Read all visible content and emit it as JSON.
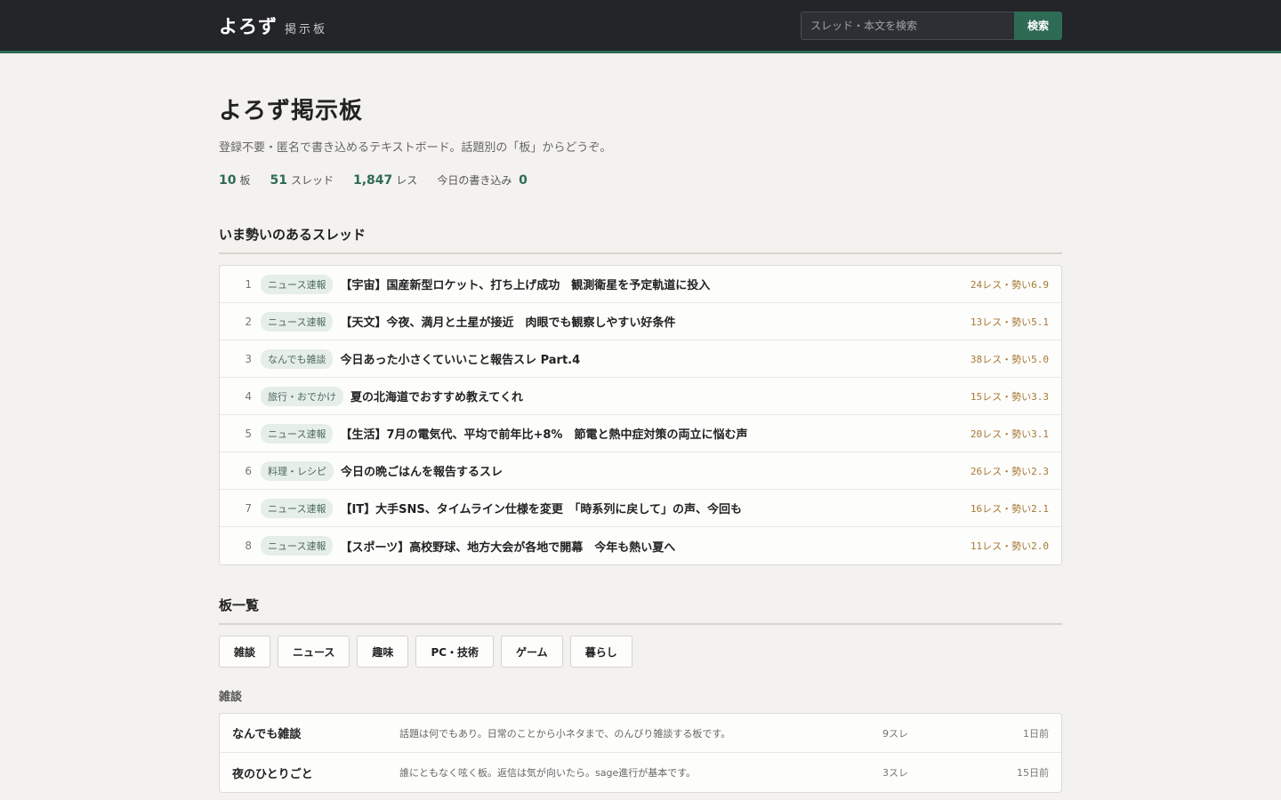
{
  "header": {
    "brand": "よろず",
    "brand_sub": "掲示板",
    "search_placeholder": "スレッド・本文を検索",
    "search_button": "検索"
  },
  "hero": {
    "title": "よろず掲示板",
    "description": "登録不要・匿名で書き込めるテキストボード。話題別の「板」からどうぞ。",
    "stats": [
      {
        "num": "10",
        "label": "板"
      },
      {
        "num": "51",
        "label": "スレッド"
      },
      {
        "num": "1,847",
        "label": "レス"
      },
      {
        "num": "0",
        "label": "今日の書き込み",
        "label_first": true
      }
    ]
  },
  "hot": {
    "title": "いま勢いのあるスレッド",
    "threads": [
      {
        "rank": "1",
        "tag": "ニュース速報",
        "title": "【宇宙】国産新型ロケット、打ち上げ成功　観測衛星を予定軌道に投入",
        "meta": "24レス・勢い6.9"
      },
      {
        "rank": "2",
        "tag": "ニュース速報",
        "title": "【天文】今夜、満月と土星が接近　肉眼でも観察しやすい好条件",
        "meta": "13レス・勢い5.1"
      },
      {
        "rank": "3",
        "tag": "なんでも雑談",
        "title": "今日あった小さくていいこと報告スレ Part.4",
        "meta": "38レス・勢い5.0"
      },
      {
        "rank": "4",
        "tag": "旅行・おでかけ",
        "title": "夏の北海道でおすすめ教えてくれ",
        "meta": "15レス・勢い3.3"
      },
      {
        "rank": "5",
        "tag": "ニュース速報",
        "title": "【生活】7月の電気代、平均で前年比+8%　節電と熱中症対策の両立に悩む声",
        "meta": "20レス・勢い3.1"
      },
      {
        "rank": "6",
        "tag": "料理・レシピ",
        "title": "今日の晩ごはんを報告するスレ",
        "meta": "26レス・勢い2.3"
      },
      {
        "rank": "7",
        "tag": "ニュース速報",
        "title": "【IT】大手SNS、タイムライン仕様を変更　「時系列に戻して」の声、今回も",
        "meta": "16レス・勢い2.1"
      },
      {
        "rank": "8",
        "tag": "ニュース速報",
        "title": "【スポーツ】高校野球、地方大会が各地で開幕　今年も熱い夏へ",
        "meta": "11レス・勢い2.0"
      }
    ]
  },
  "boards": {
    "title": "板一覧",
    "tabs": [
      "雑談",
      "ニュース",
      "趣味",
      "PC・技術",
      "ゲーム",
      "暮らし"
    ],
    "category": "雑談",
    "rows": [
      {
        "name": "なんでも雑談",
        "desc": "話題は何でもあり。日常のことから小ネタまで、のんびり雑談する板です。",
        "count": "9スレ",
        "time": "1日前"
      },
      {
        "name": "夜のひとりごと",
        "desc": "誰にともなく呟く板。返信は気が向いたら。sage進行が基本です。",
        "count": "3スレ",
        "time": "15日前"
      }
    ]
  }
}
